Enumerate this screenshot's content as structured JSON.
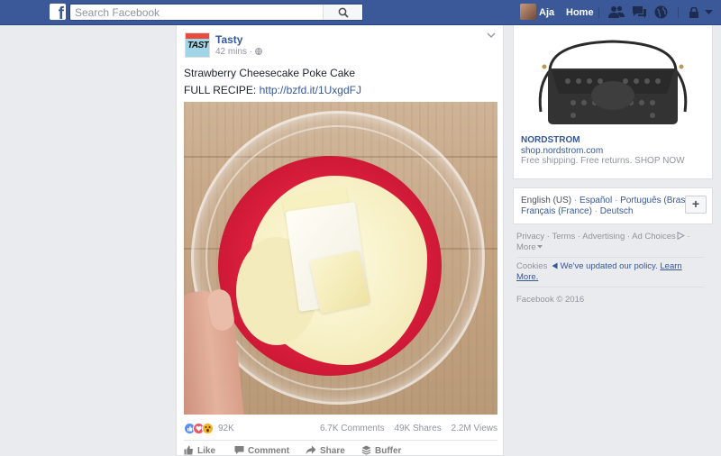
{
  "topbar": {
    "logo": "f",
    "search_placeholder": "Search Facebook",
    "user_name": "Aja",
    "home_label": "Home",
    "icons": [
      "friend-requests-icon",
      "messages-icon",
      "notifications-globe-icon",
      "privacy-shortcuts-icon",
      "chevron-down-icon"
    ]
  },
  "post": {
    "page_name": "Tasty",
    "avatar_text": "TASTY",
    "time": "42 mins",
    "privacy_icon": "globe-icon",
    "title": "Strawberry Cheesecake Poke Cake",
    "link_prefix": "FULL RECIPE: ",
    "link_text": "http://bzfd.it/1UxgdFJ",
    "reaction_count": "92K",
    "comments": "6.7K Comments",
    "shares": "49K Shares",
    "views": "2.2M Views",
    "actions": {
      "like": "Like",
      "comment": "Comment",
      "share": "Share",
      "buffer": "Buffer"
    }
  },
  "ad": {
    "brand": "NORDSTROM",
    "url": "shop.nordstrom.com",
    "text": "Free shipping. Free returns. SHOP NOW"
  },
  "languages": {
    "current": "English (US)",
    "l1": "Español",
    "l2": "Português (Brasil)",
    "l3": "Français (France)",
    "l4": "Deutsch",
    "sep": " · ",
    "add_label": "+"
  },
  "footer": {
    "privacy": "Privacy",
    "terms": "Terms",
    "advertising": "Advertising",
    "ad_choices": "Ad Choices",
    "more": "More",
    "sep": " · ",
    "cookies": "Cookies",
    "policy_update": "We've updated our policy.",
    "learn_more": "Learn More.",
    "copyright": "Facebook © 2016"
  },
  "colors": {
    "brand_blue": "#3b5998",
    "link_blue": "#365899",
    "muted": "#90949c",
    "background": "#e9ebee"
  }
}
